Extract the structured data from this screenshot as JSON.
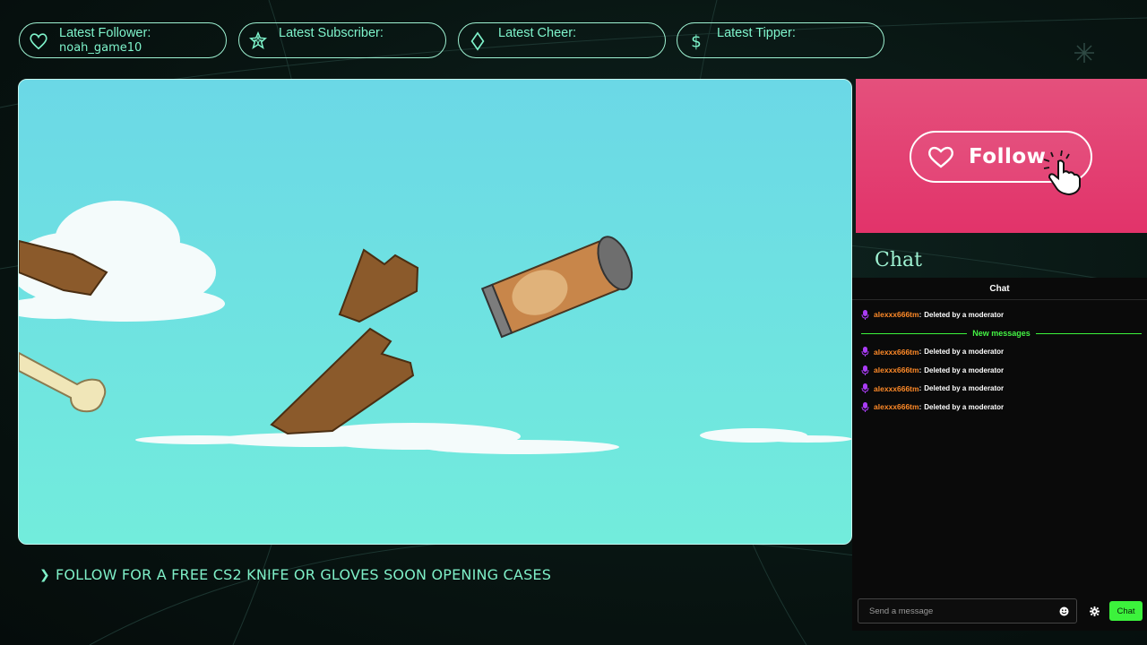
{
  "alerts": [
    {
      "label": "Latest Follower:",
      "value": "noah_game10",
      "icon": "heart-icon"
    },
    {
      "label": "Latest Subscriber:",
      "value": "",
      "icon": "star-icon"
    },
    {
      "label": "Latest Cheer:",
      "value": "",
      "icon": "diamond-icon"
    },
    {
      "label": "Latest Tipper:",
      "value": "",
      "icon": "dollar-icon"
    }
  ],
  "follow": {
    "label": "Follow",
    "bg_color": "#e2336a"
  },
  "chat_heading": "Chat",
  "chat": {
    "header": "Chat",
    "divider_label": "New messages",
    "messages_before": [
      {
        "user": "alexxx666tm",
        "text": "Deleted by a moderator"
      }
    ],
    "messages_after": [
      {
        "user": "alexxx666tm",
        "text": "Deleted by a moderator"
      },
      {
        "user": "alexxx666tm",
        "text": "Deleted by a moderator"
      },
      {
        "user": "alexxx666tm",
        "text": "Deleted by a moderator"
      },
      {
        "user": "alexxx666tm",
        "text": "Deleted by a moderator"
      }
    ],
    "input_placeholder": "Send a message",
    "send_label": "Chat",
    "accent_color": "#3cf23c",
    "username_color": "#ff8a28"
  },
  "ticker": "FOLLOW FOR A FREE CS2 KNIFE OR GLOVES SOON OPENING CASES",
  "theme": {
    "accent": "#7ff0c8",
    "background": "#081512"
  }
}
